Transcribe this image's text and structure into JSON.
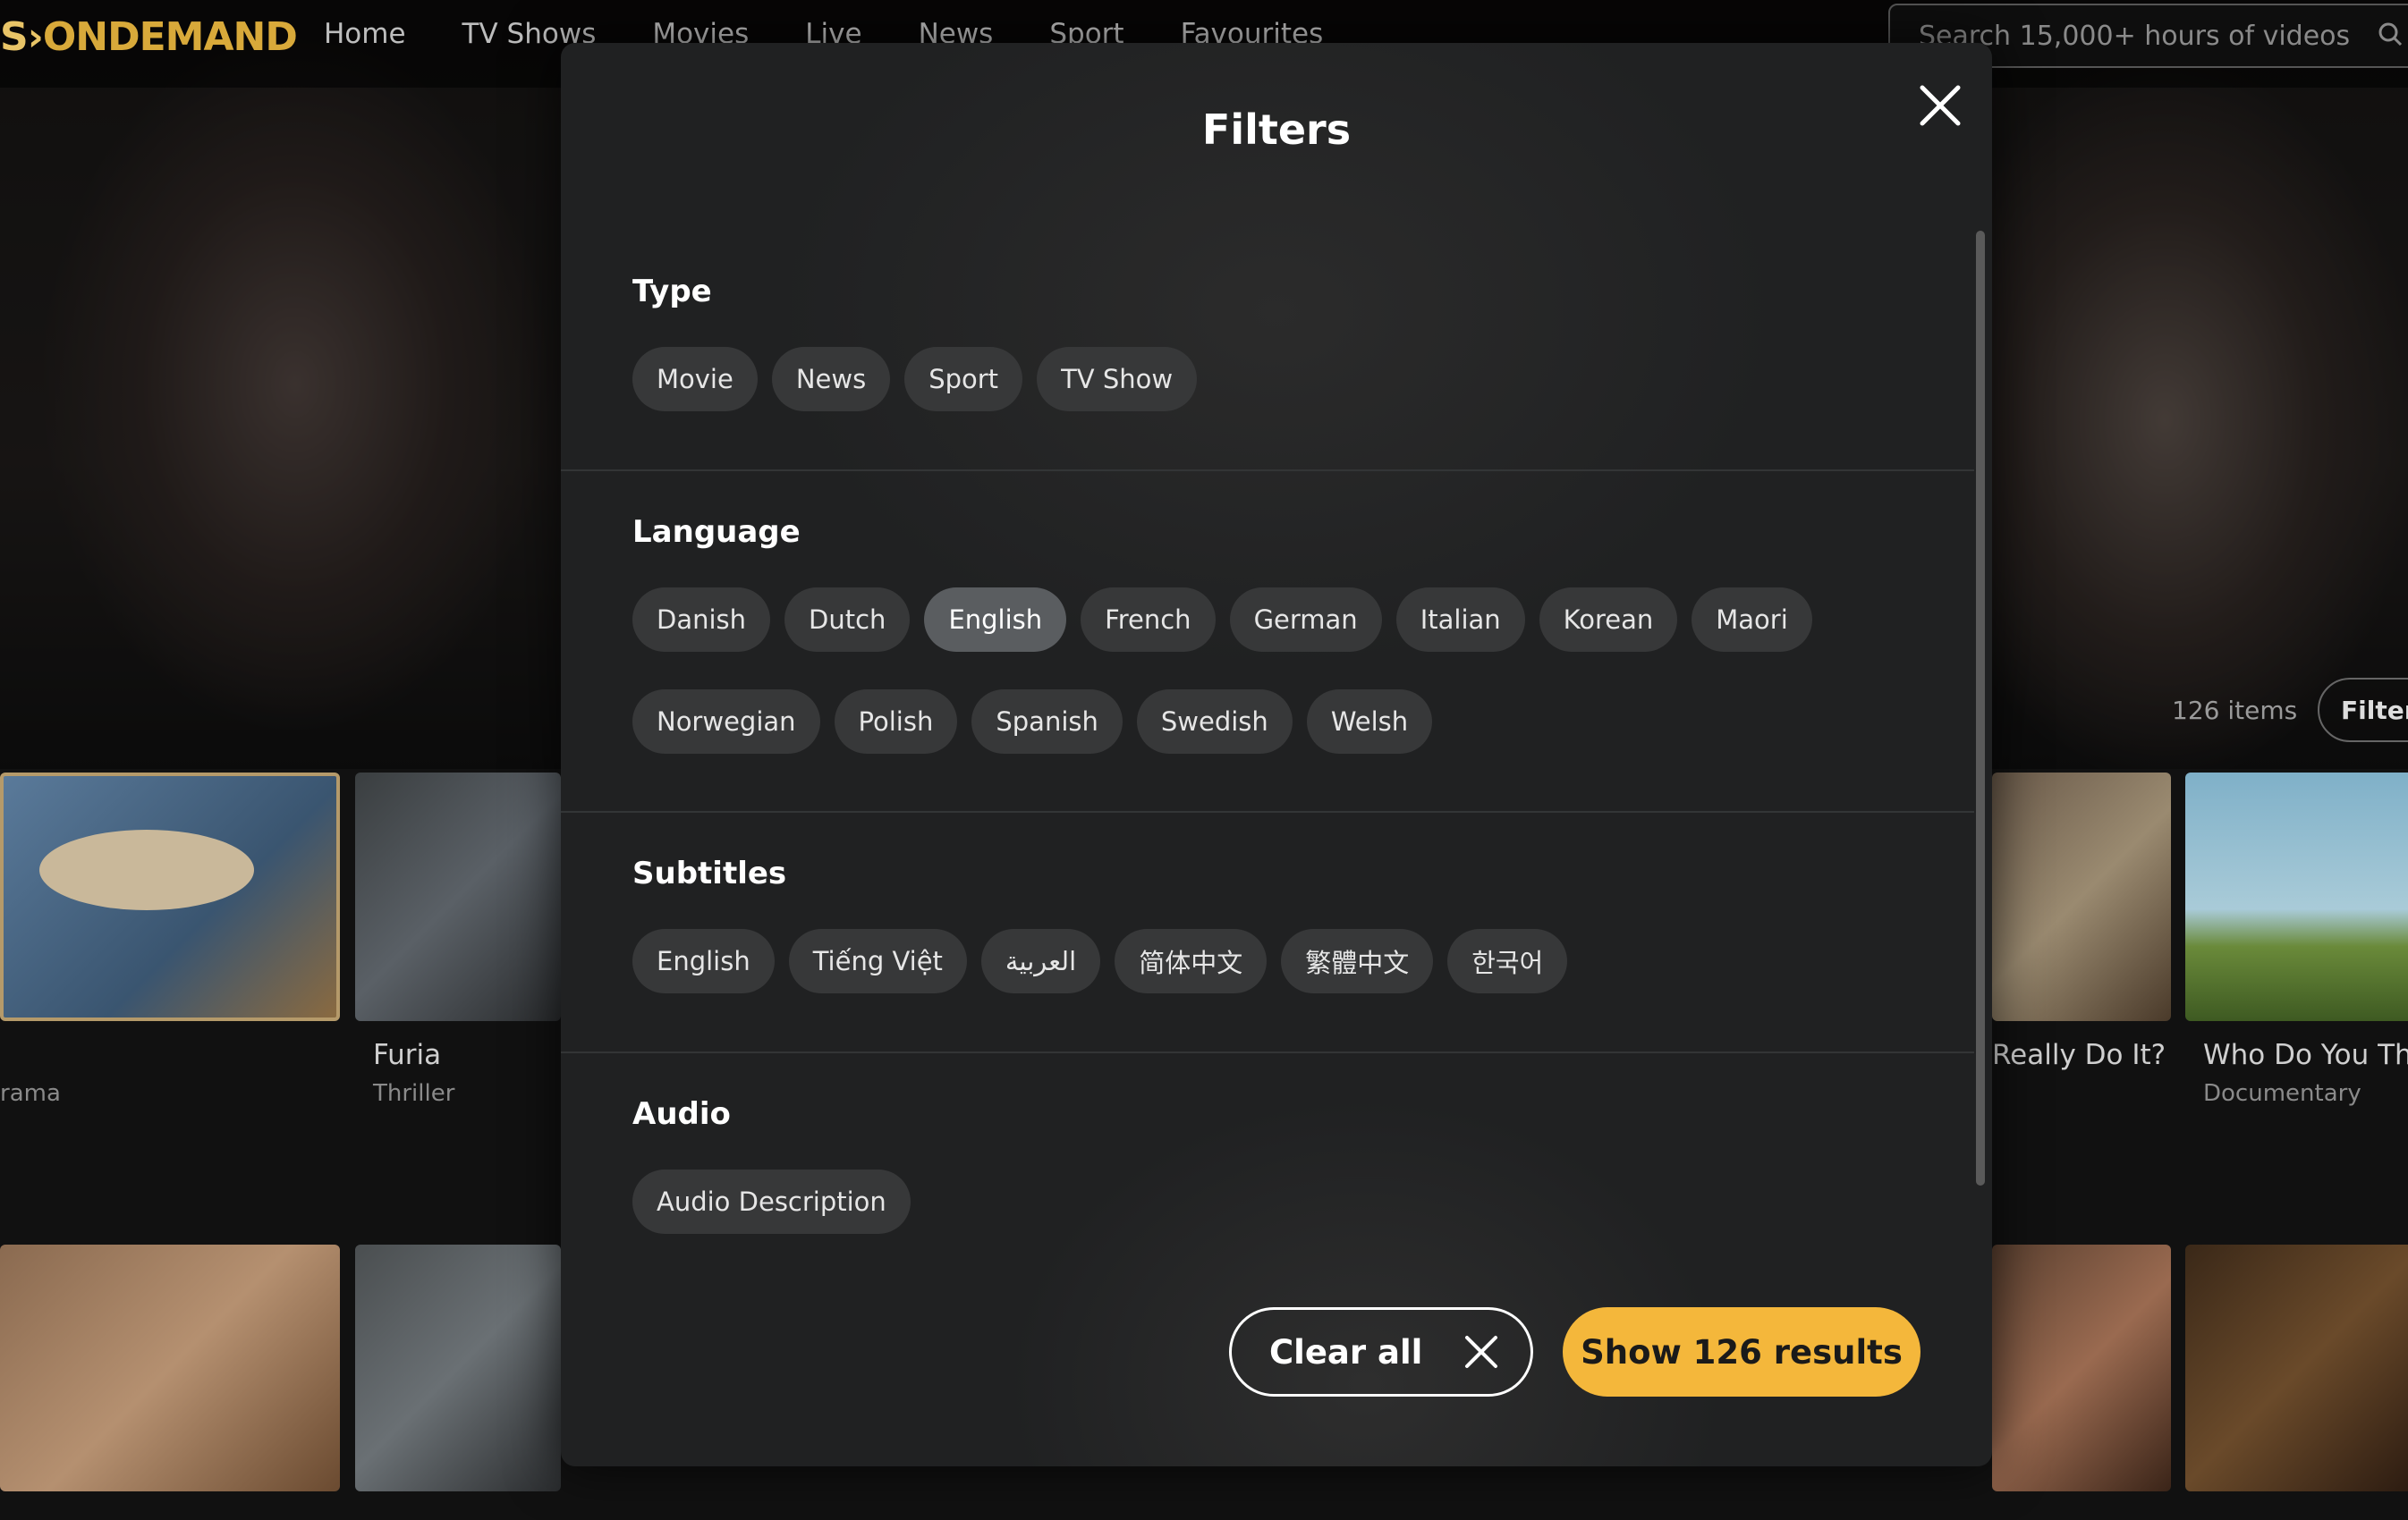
{
  "header": {
    "logo_prefix": "S",
    "logo_main": "ONDEMAND",
    "nav": [
      "Home",
      "TV Shows",
      "Movies",
      "Live",
      "News",
      "Sport",
      "Favourites"
    ],
    "search_placeholder": "Search 15,000+ hours of videos"
  },
  "listing": {
    "items_count": "126 items",
    "filter_label": "Filter",
    "cards": [
      {
        "title": "",
        "subtitle": "rama"
      },
      {
        "title": "Furia",
        "subtitle": "Thriller"
      },
      {
        "title": "Really Do It?",
        "subtitle": ""
      },
      {
        "title": "Who Do You Thi",
        "subtitle": "Documentary"
      }
    ]
  },
  "modal": {
    "title": "Filters",
    "sections": [
      {
        "title": "Type",
        "options": [
          "Movie",
          "News",
          "Sport",
          "TV Show"
        ]
      },
      {
        "title": "Language",
        "options": [
          "Danish",
          "Dutch",
          "English",
          "French",
          "German",
          "Italian",
          "Korean",
          "Maori",
          "Norwegian",
          "Polish",
          "Spanish",
          "Swedish",
          "Welsh"
        ],
        "selected": "English"
      },
      {
        "title": "Subtitles",
        "options": [
          "English",
          "Tiếng Việt",
          "العربية",
          "简体中文",
          "繁體中文",
          "한국어"
        ]
      },
      {
        "title": "Audio",
        "options": [
          "Audio Description"
        ]
      }
    ],
    "clear_all": "Clear all",
    "show_results": "Show 126 results"
  },
  "colors": {
    "accent": "#f4b73b",
    "chip_bg": "#373839",
    "chip_selected_bg": "#5a5d60",
    "modal_bg": "#202122"
  }
}
